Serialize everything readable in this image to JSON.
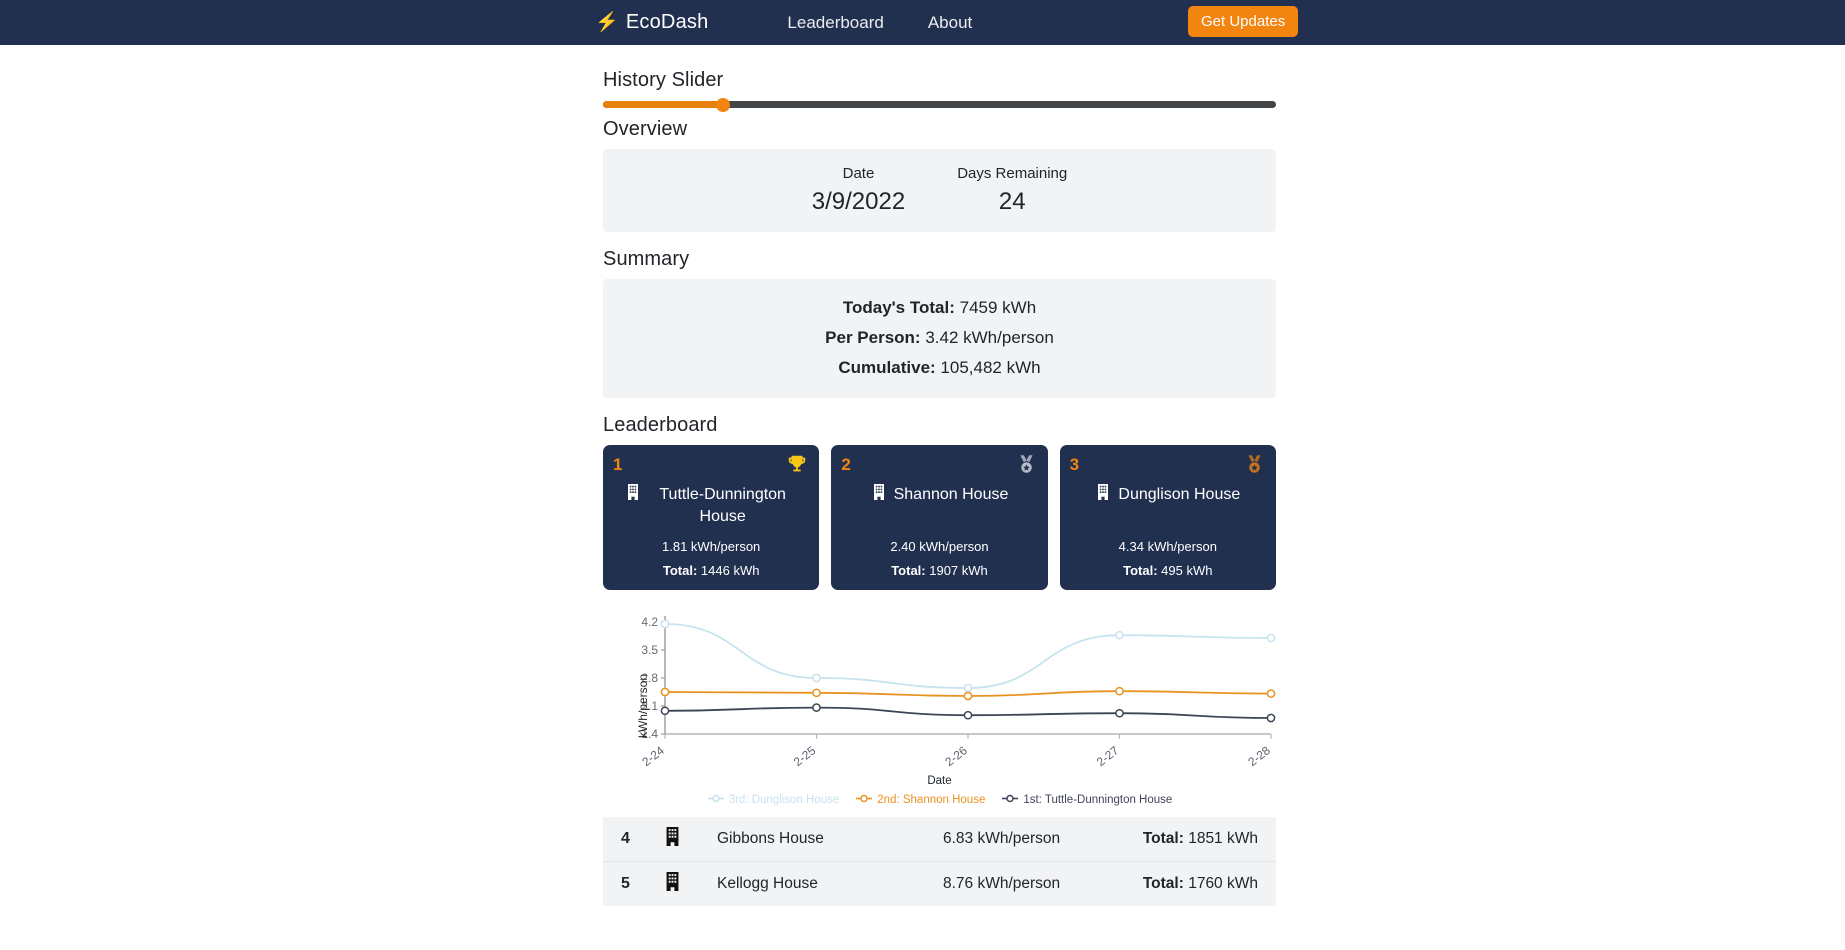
{
  "navbar": {
    "brand": "EcoDash",
    "brand_icon": "lightning-bolt-icon",
    "links": [
      {
        "label": "Leaderboard"
      },
      {
        "label": "About"
      }
    ],
    "cta_label": "Get Updates",
    "accent_color": "#f28410",
    "background_color": "#22304f"
  },
  "slider": {
    "title": "History Slider",
    "value_percent": 17.8
  },
  "overview": {
    "title": "Overview",
    "date_label": "Date",
    "date_value": "3/9/2022",
    "days_label": "Days Remaining",
    "days_value": "24"
  },
  "summary": {
    "title": "Summary",
    "today_label": "Today's Total:",
    "today_value": "7459 kWh",
    "person_label": "Per Person:",
    "person_value": "3.42 kWh/person",
    "cumulative_label": "Cumulative:",
    "cumulative_value": "105,482 kWh"
  },
  "leaderboard": {
    "title": "Leaderboard",
    "podium": [
      {
        "rank": "1",
        "name": "Tuttle-Dunnington House",
        "per_person": "1.81 kWh/person",
        "total_label": "Total:",
        "total_value": "1446 kWh",
        "medal": "trophy-icon",
        "medal_color": "#f5c518"
      },
      {
        "rank": "2",
        "name": "Shannon House",
        "per_person": "2.40 kWh/person",
        "total_label": "Total:",
        "total_value": "1907 kWh",
        "medal": "silver-medal-icon",
        "medal_color": "#b6bdc9"
      },
      {
        "rank": "3",
        "name": "Dunglison House",
        "per_person": "4.34 kWh/person",
        "total_label": "Total:",
        "total_value": "495 kWh",
        "medal": "bronze-medal-icon",
        "medal_color": "#c5741b"
      }
    ],
    "rows": [
      {
        "rank": "4",
        "name": "Gibbons House",
        "per_person": "6.83 kWh/person",
        "total_label": "Total:",
        "total_value": "1851 kWh"
      },
      {
        "rank": "5",
        "name": "Kellogg House",
        "per_person": "8.76 kWh/person",
        "total_label": "Total:",
        "total_value": "1760 kWh"
      }
    ]
  },
  "chart_data": {
    "type": "line",
    "title": "",
    "xlabel": "Date",
    "ylabel": "kWh/person",
    "categories": [
      "2-24",
      "2-25",
      "2-26",
      "2-27",
      "2-28"
    ],
    "yticks": [
      1.4,
      2.1,
      2.8,
      3.5,
      4.2
    ],
    "ylim": [
      1.4,
      4.35
    ],
    "grid": false,
    "legend_position": "bottom",
    "series": [
      {
        "name": "3rd: Dunglison House",
        "color": "#c7e3ef",
        "values": [
          4.15,
          2.8,
          2.55,
          3.87,
          3.8
        ]
      },
      {
        "name": "2nd: Shannon House",
        "color": "#e8931f",
        "values": [
          2.45,
          2.43,
          2.35,
          2.47,
          2.41
        ]
      },
      {
        "name": "1st: Tuttle-Dunnington House",
        "color": "#3d4557",
        "values": [
          1.98,
          2.06,
          1.87,
          1.92,
          1.8
        ]
      }
    ]
  }
}
